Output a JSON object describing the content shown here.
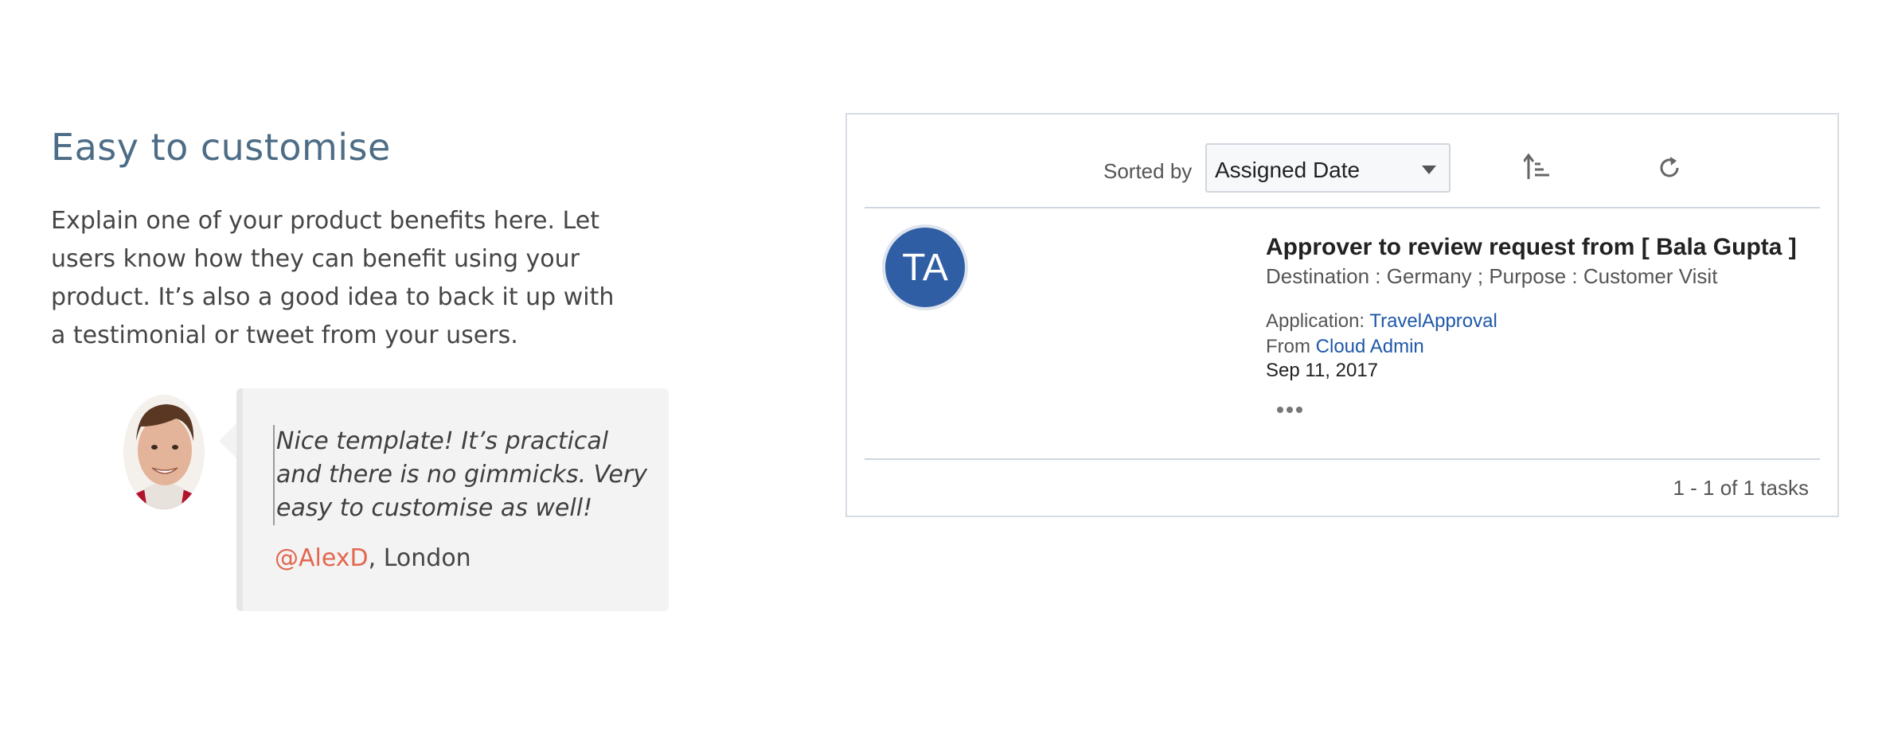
{
  "feature": {
    "heading": "Easy to customise",
    "body": "Explain one of your product benefits here. Let users know how they can benefit using your product. It’s also a good idea to back it up with a testimonial or tweet from your users.",
    "testimonial": {
      "quote": "Nice template! It’s practical and there is no gimmicks. Very easy to customise as well!",
      "handle": "@AlexD",
      "location": ", London"
    }
  },
  "task_panel": {
    "sort": {
      "label": "Sorted by",
      "selected": "Assigned Date"
    },
    "icons": {
      "sort_order": "sort-ascending-icon",
      "refresh": "refresh-icon",
      "more": "more-options-icon"
    },
    "task": {
      "initials": "TA",
      "title": "Approver to review request from [ Bala Gupta ]",
      "subtitle": "Destination : Germany ; Purpose : Customer Visit",
      "application_label": "Application: ",
      "application": "TravelApproval",
      "from_label": "From ",
      "from": "Cloud Admin",
      "date": "Sep 11, 2017"
    },
    "count": "1 - 1 of 1 tasks"
  },
  "colors": {
    "heading": "#4d6d87",
    "handle": "#e2674f",
    "avatar_bg": "#2f5ea5",
    "link": "#1f58a8"
  }
}
